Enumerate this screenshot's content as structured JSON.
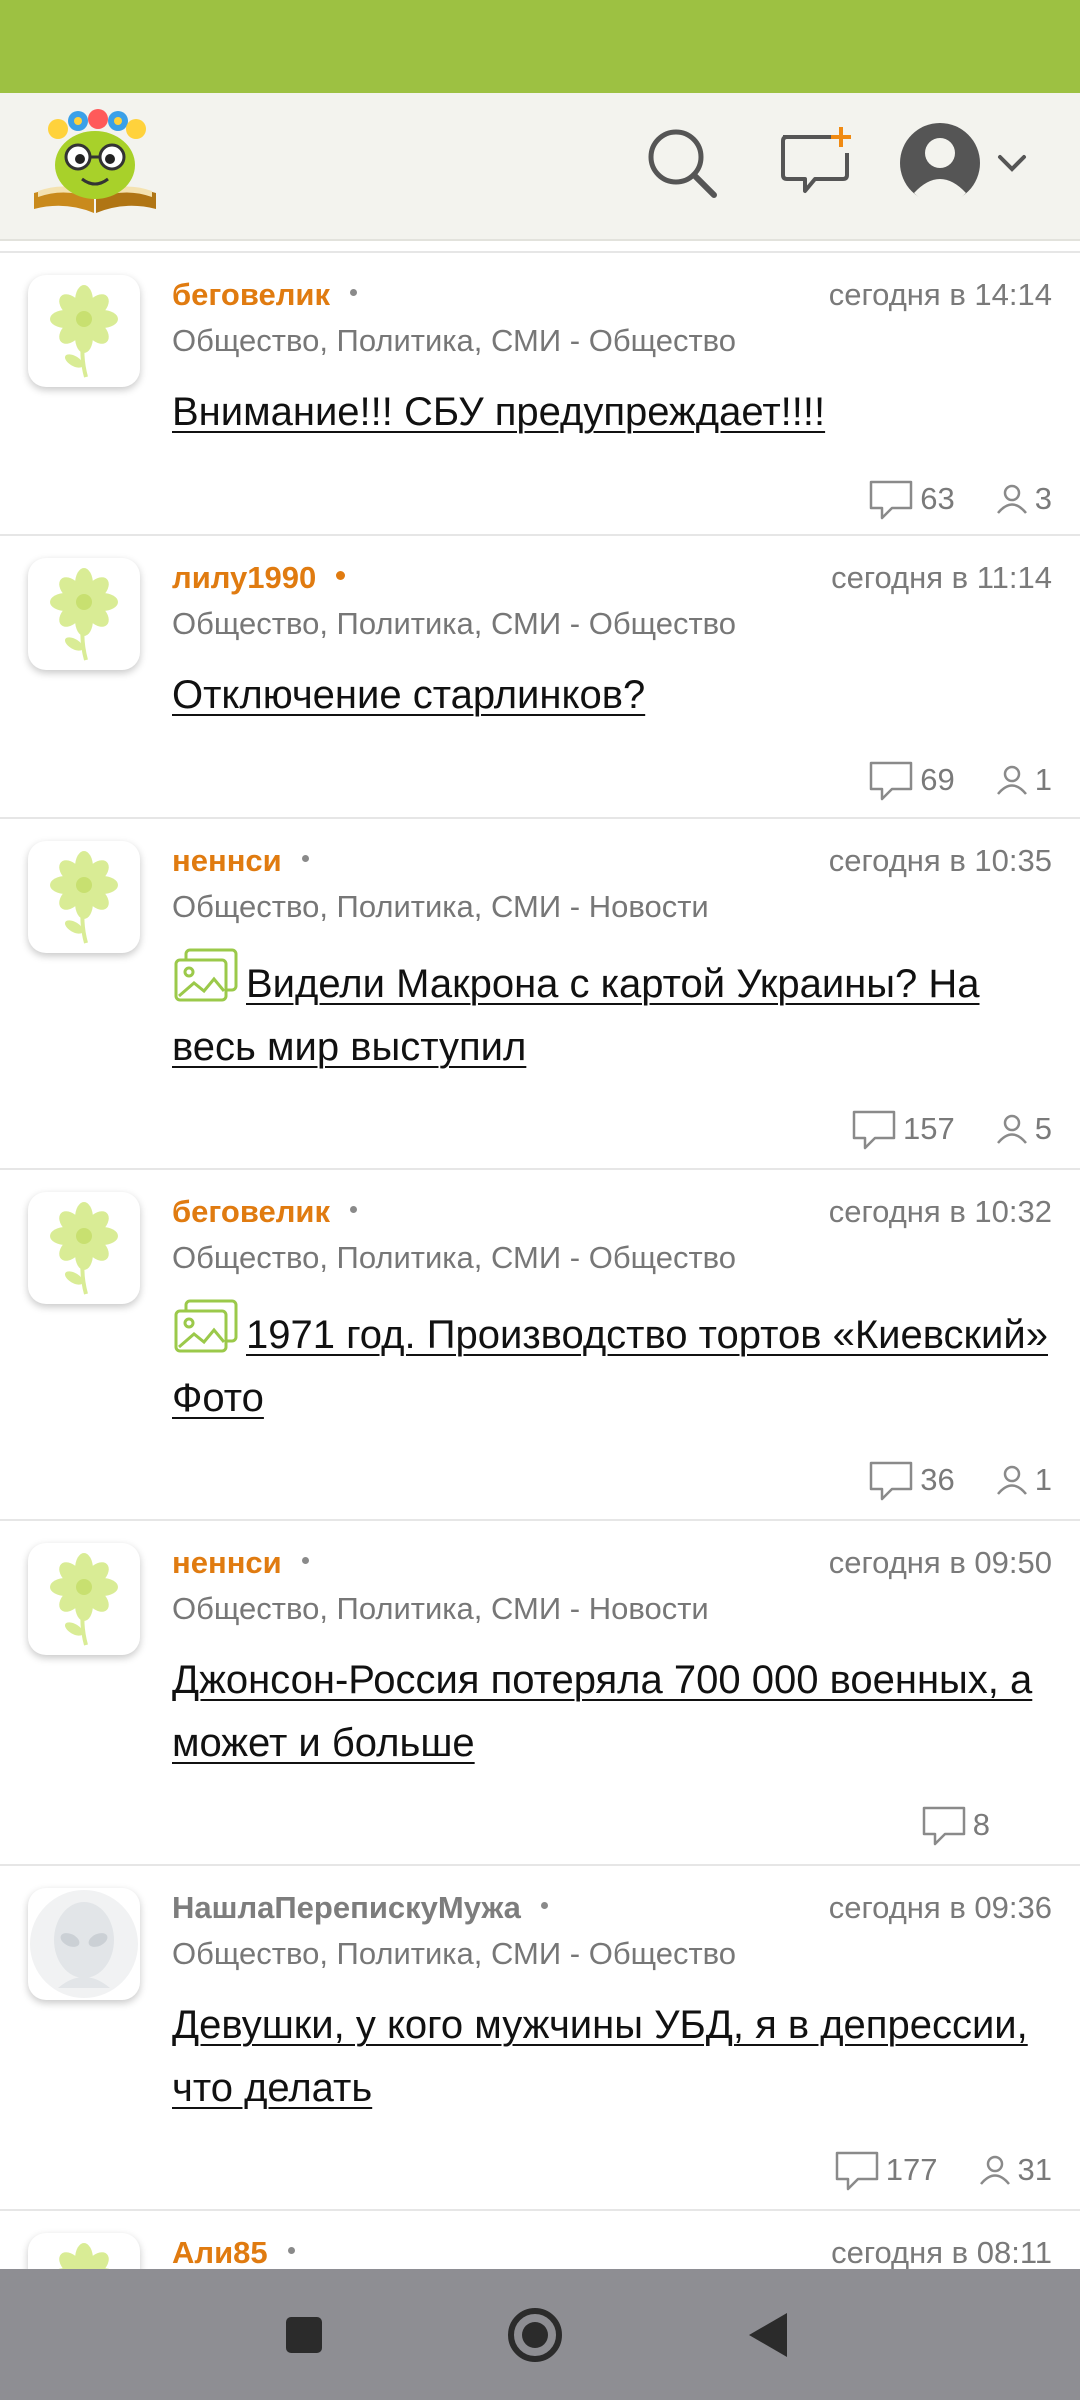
{
  "feed": {
    "items": [
      {
        "author": "беговелик",
        "time": "сегодня в 14:14",
        "category": "Общество, Политика, СМИ - Общество",
        "title": "Внимание!!! СБУ предупреждает!!!!",
        "comments": "63",
        "participants": "3"
      },
      {
        "author": "лилу1990",
        "time": "сегодня в 11:14",
        "category": "Общество, Политика, СМИ - Общество",
        "title": "Отключение старлинков?",
        "comments": "69",
        "participants": "1"
      },
      {
        "author": "неннси",
        "time": "сегодня в 10:35",
        "category": "Общество, Политика, СМИ - Новости",
        "title": "Видели Макрона с картой Украины? На весь мир выступил",
        "comments": "157",
        "participants": "5"
      },
      {
        "author": "беговелик",
        "time": "сегодня в 10:32",
        "category": "Общество, Политика, СМИ - Общество",
        "title": "1971 год. Производство тортов «Киевский» Фото",
        "comments": "36",
        "participants": "1"
      },
      {
        "author": "неннси",
        "time": "сегодня в 09:50",
        "category": "Общество, Политика, СМИ - Новости",
        "title": "Джонсон-Россия потеряла 700 000 военных, а может и больше",
        "comments": "8"
      },
      {
        "author": "НашлаПерепискуМужа",
        "time": "сегодня в 09:36",
        "category": "Общество, Политика, СМИ - Общество",
        "title": "Девушки, у кого мужчины УБД, я в депрессии, что делать",
        "comments": "177",
        "participants": "31"
      },
      {
        "author": "Али85",
        "time": "сегодня в 08:11"
      }
    ]
  },
  "colors": {
    "status_bar": "#9dc142",
    "author_orange": "#e07b10",
    "nav_bar": "#8e8e93"
  }
}
